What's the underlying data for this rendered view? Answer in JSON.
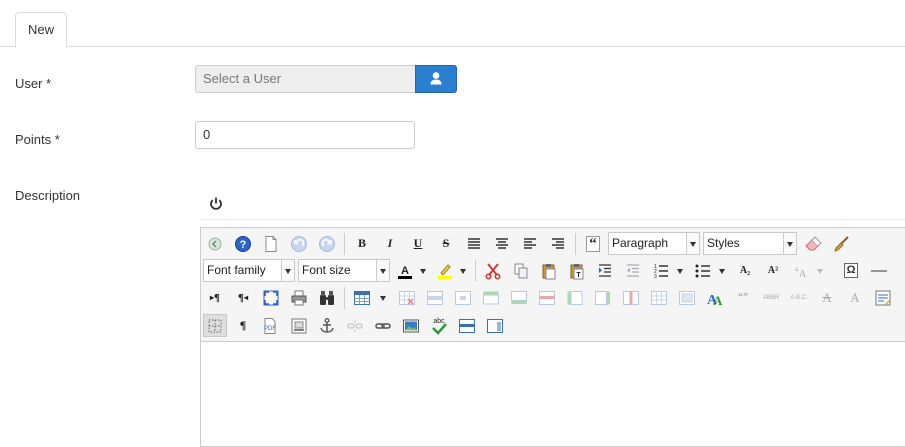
{
  "tabs": [
    {
      "label": "New",
      "active": true
    }
  ],
  "form": {
    "user": {
      "label": "User *",
      "placeholder": "Select a User",
      "button_icon": "user-icon"
    },
    "points": {
      "label": "Points *",
      "value": "0"
    },
    "description": {
      "label": "Description",
      "toggle_icon": "power-icon"
    }
  },
  "editor": {
    "format_select": "Paragraph",
    "styles_select": "Styles",
    "font_family_select": "Font family",
    "font_size_select": "Font size",
    "bold_label": "B",
    "italic_label": "I",
    "underline_label": "U",
    "strike_label": "S",
    "blockquote_label": "“",
    "rtl_label": "¶",
    "ltr_label": "¶",
    "show_blocks_label": "¶",
    "subscript_label": "A₂",
    "superscript_label": "A²",
    "charmap_label": "Ω",
    "cite_label": "“”",
    "abbr_label": "ABBR",
    "acronym_label": "A.B.C.",
    "del_label": "A",
    "ins_label": "A",
    "spellcheck_label": "abc"
  },
  "colors": {
    "accent": "#2a7fd0",
    "forecolor": "#000000",
    "backcolor": "#ffff00"
  }
}
